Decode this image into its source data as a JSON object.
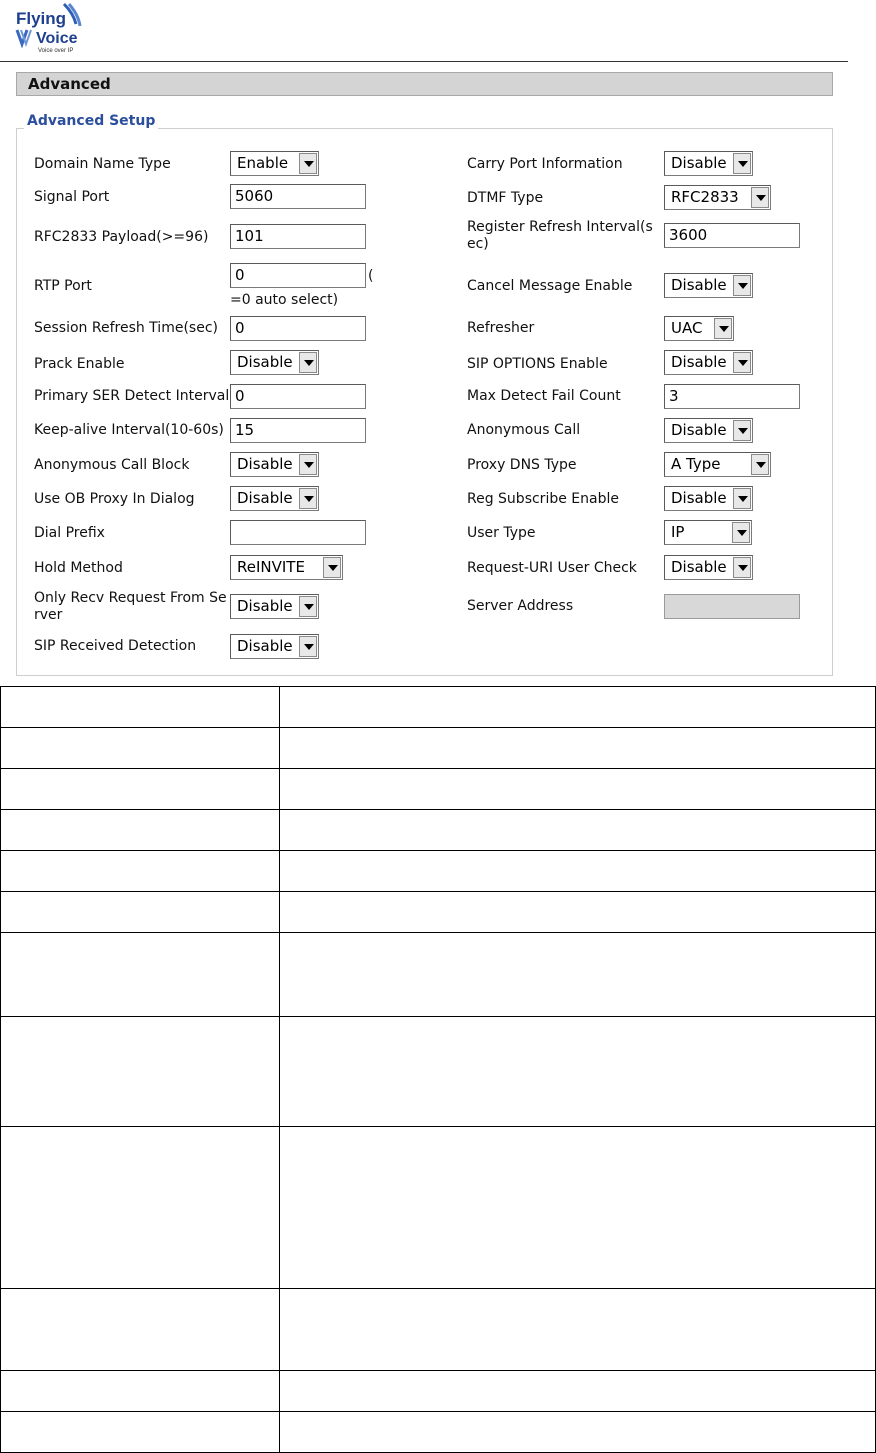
{
  "brand": {
    "logo_line1": "Flying",
    "logo_line2": "Voice",
    "logo_tagline": "Voice over IP",
    "logo_color": "#1f3f8f"
  },
  "section": {
    "title": "Advanced"
  },
  "fieldset": {
    "legend": "Advanced Setup"
  },
  "left_fields": {
    "domain_name_type": {
      "label": "Domain Name Type",
      "value": "Enable"
    },
    "signal_port": {
      "label": "Signal Port",
      "value": "5060"
    },
    "rfc2833_payload": {
      "label": "RFC2833 Payload(>=96)",
      "value": "101"
    },
    "rtp_port": {
      "label": "RTP Port",
      "value": "0",
      "suffix_open": "(",
      "note": "=0 auto select)"
    },
    "session_refresh_time": {
      "label": "Session Refresh Time(sec)",
      "value": "0"
    },
    "prack_enable": {
      "label": "Prack Enable",
      "value": "Disable"
    },
    "primary_ser_detect_interval": {
      "label": "Primary SER Detect Interval",
      "value": "0"
    },
    "keep_alive_interval": {
      "label": "Keep-alive Interval(10-60s)",
      "value": "15"
    },
    "anonymous_call_block": {
      "label": "Anonymous Call Block",
      "value": "Disable"
    },
    "use_ob_proxy_in_dialog": {
      "label": "Use OB Proxy In Dialog",
      "value": "Disable"
    },
    "dial_prefix": {
      "label": "Dial Prefix",
      "value": ""
    },
    "hold_method": {
      "label": "Hold Method",
      "value": "ReINVITE"
    },
    "only_recv_request": {
      "label": "Only Recv Request From Se rver",
      "value": "Disable"
    },
    "sip_received_detection": {
      "label": "SIP Received Detection",
      "value": "Disable"
    }
  },
  "right_fields": {
    "carry_port_information": {
      "label": "Carry Port Information",
      "value": "Disable"
    },
    "dtmf_type": {
      "label": "DTMF Type",
      "value": "RFC2833"
    },
    "register_refresh_interval": {
      "label": "Register Refresh Interval(s ec)",
      "value": "3600"
    },
    "cancel_message_enable": {
      "label": "Cancel Message Enable",
      "value": "Disable"
    },
    "refresher": {
      "label": "Refresher",
      "value": "UAC"
    },
    "sip_options_enable": {
      "label": "SIP OPTIONS Enable",
      "value": "Disable"
    },
    "max_detect_fail_count": {
      "label": "Max Detect Fail Count",
      "value": "3"
    },
    "anonymous_call": {
      "label": "Anonymous Call",
      "value": "Disable"
    },
    "proxy_dns_type": {
      "label": "Proxy DNS Type",
      "value": "A Type"
    },
    "reg_subscribe_enable": {
      "label": "Reg Subscribe Enable",
      "value": "Disable"
    },
    "user_type": {
      "label": "User Type",
      "value": "IP"
    },
    "request_uri_user_check": {
      "label": "Request-URI User Check",
      "value": "Disable"
    },
    "server_address": {
      "label": "Server Address",
      "value": ""
    }
  },
  "description_table": {
    "rows": 13
  }
}
